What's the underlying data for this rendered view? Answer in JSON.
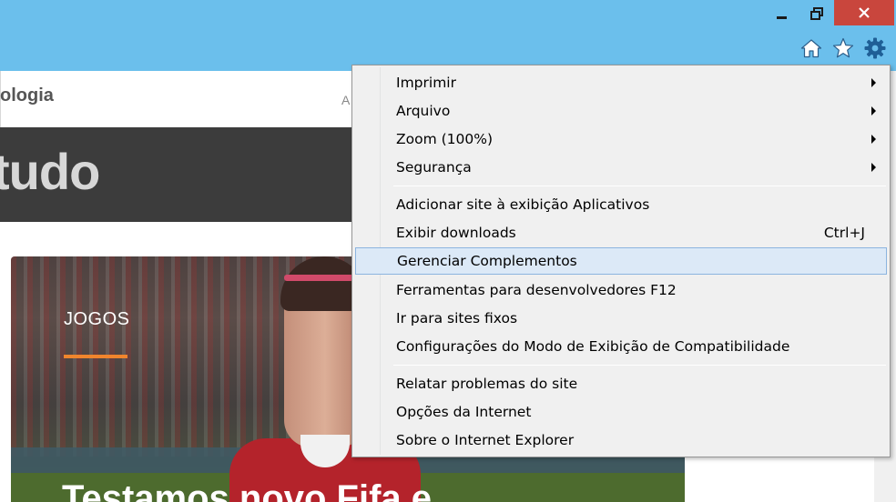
{
  "window": {
    "controls": {
      "minimize_icon": "minimize-icon",
      "restore_icon": "restore-icon",
      "close_icon": "close-icon"
    },
    "toolbar_icons": [
      "home-icon",
      "star-icon",
      "gear-icon"
    ]
  },
  "page": {
    "header_text": "ologia",
    "header_link": "A",
    "banner_logo": "tudo",
    "hero": {
      "category": "JOGOS",
      "title": "Testamos novo Fifa e"
    }
  },
  "menu": {
    "items": [
      {
        "label": "Imprimir",
        "submenu": true
      },
      {
        "label": "Arquivo",
        "submenu": true
      },
      {
        "label": "Zoom (100%)",
        "submenu": true
      },
      {
        "label": "Segurança",
        "submenu": true
      },
      {
        "label": "Adicionar site à exibição Aplicativos"
      },
      {
        "label": "Exibir downloads",
        "shortcut": "Ctrl+J"
      },
      {
        "label": "Gerenciar Complementos",
        "highlighted": true
      },
      {
        "label": "Ferramentas para desenvolvedores F12"
      },
      {
        "label": "Ir para sites fixos"
      },
      {
        "label": "Configurações do Modo de Exibição de Compatibilidade"
      },
      {
        "label": "Relatar problemas do site"
      },
      {
        "label": "Opções da Internet"
      },
      {
        "label": "Sobre o Internet Explorer"
      }
    ]
  },
  "colors": {
    "titlebar": "#6bbfec",
    "close_button": "#c9463d",
    "menu_highlight": "#dce9f7",
    "accent_bar": "#f0852d"
  }
}
